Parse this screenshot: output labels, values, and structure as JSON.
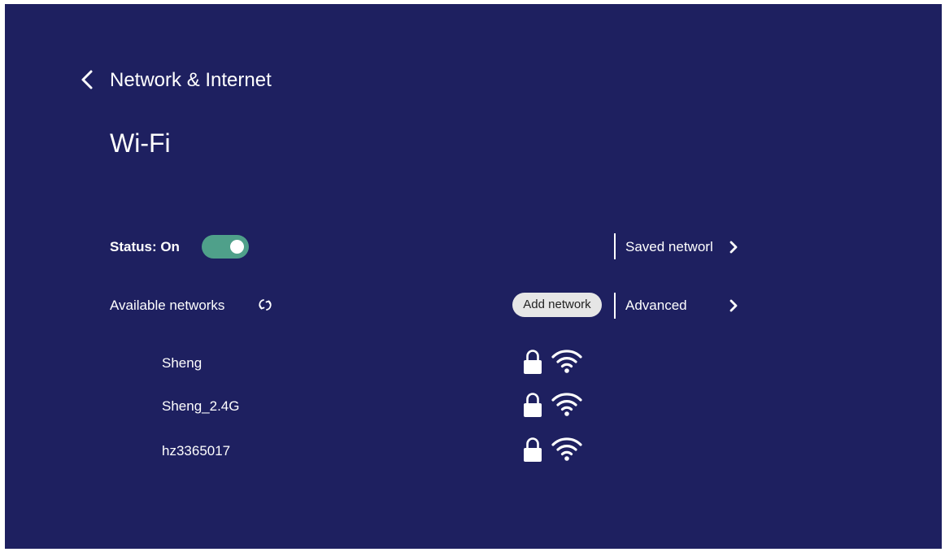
{
  "header": {
    "back_icon": "chevron-left-icon",
    "title": "Network & Internet"
  },
  "page": {
    "title": "Wi-Fi"
  },
  "status": {
    "label": "Status: On",
    "wifi_enabled": true
  },
  "menu": {
    "saved_networks_label": "Saved networl",
    "advanced_label": "Advanced"
  },
  "available": {
    "label": "Available networks",
    "refresh_icon": "refresh-icon",
    "add_network_label": "Add network"
  },
  "networks": [
    {
      "name": "Sheng",
      "secured": true,
      "signal": "full"
    },
    {
      "name": "Sheng_2.4G",
      "secured": true,
      "signal": "full"
    },
    {
      "name": "hz3365017",
      "secured": true,
      "signal": "full"
    }
  ],
  "colors": {
    "background": "#1e2060",
    "toggle_on": "#4fa08a",
    "add_button_bg": "#e6e6e6",
    "text": "#ffffff"
  }
}
